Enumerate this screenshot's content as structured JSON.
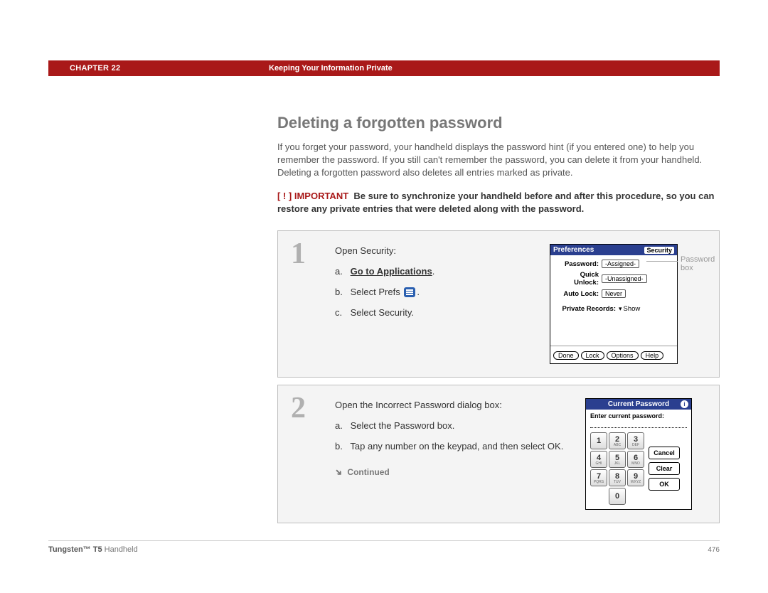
{
  "header": {
    "chapter": "CHAPTER 22",
    "title": "Keeping Your Information Private"
  },
  "heading": "Deleting a forgotten password",
  "intro": "If you forget your password, your handheld displays the password hint (if you entered one) to help you remember the password. If you still can't remember the password, you can delete it from your handheld. Deleting a forgotten password also deletes all entries marked as private.",
  "important": {
    "badge_prefix": "[ ! ]",
    "badge_word": "IMPORTANT",
    "text": "Be sure to synchronize your handheld before and after this procedure, so you can restore any private entries that were deleted along with the password."
  },
  "step1": {
    "number": "1",
    "lead": "Open Security:",
    "a_prefix": "a.",
    "a_link": "Go to Applications",
    "a_suffix": ".",
    "b_prefix": "b.",
    "b_text1": "Select Prefs",
    "b_text2": ".",
    "c_prefix": "c.",
    "c_text": "Select Security.",
    "callout": "Password box",
    "screen": {
      "title_left": "Preferences",
      "title_right": "Security",
      "rows": {
        "password_label": "Password:",
        "password_value": "-Assigned-",
        "quick_label": "Quick Unlock:",
        "quick_value": "-Unassigned-",
        "auto_label": "Auto Lock:",
        "auto_value": "Never",
        "private_label": "Private Records:",
        "private_value": "Show"
      },
      "buttons": {
        "done": "Done",
        "lock": "Lock",
        "options": "Options",
        "help": "Help"
      }
    }
  },
  "step2": {
    "number": "2",
    "lead": "Open the Incorrect Password dialog box:",
    "a_prefix": "a.",
    "a_text": "Select the Password box.",
    "b_prefix": "b.",
    "b_text": "Tap any number on the keypad, and then select OK.",
    "continued": "Continued",
    "screen": {
      "title": "Current Password",
      "prompt": "Enter current password:",
      "keys": {
        "k1": "1",
        "k2": "2",
        "k2s": "ABC",
        "k3": "3",
        "k3s": "DEF",
        "k4": "4",
        "k4s": "GHI",
        "k5": "5",
        "k5s": "JKL",
        "k6": "6",
        "k6s": "MNO",
        "k7": "7",
        "k7s": "PQRS",
        "k8": "8",
        "k8s": "TUV",
        "k9": "9",
        "k9s": "WXYZ",
        "k0": "0"
      },
      "side": {
        "cancel": "Cancel",
        "clear": "Clear",
        "ok": "OK"
      }
    }
  },
  "footer": {
    "product_bold": "Tungsten™ T5",
    "product_rest": " Handheld",
    "page": "476"
  }
}
